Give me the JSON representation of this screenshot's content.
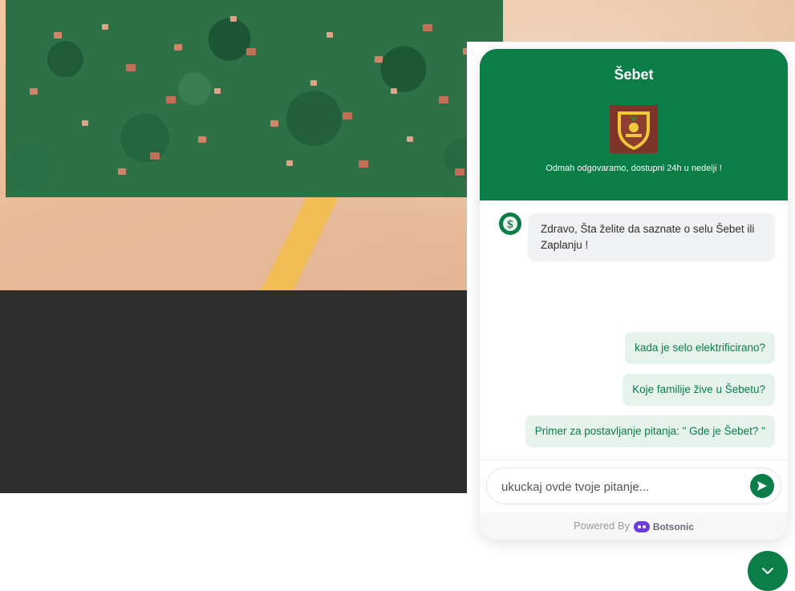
{
  "chat": {
    "title": "Šebet",
    "subtitle": "Odmah odgovaramo, dostupni 24h u nedelji !",
    "bot_message": "Zdravo, Šta želite da saznate o selu Šebet ili Zaplanju !",
    "suggestions": [
      "kada je selo elektrificirano?",
      "Koje familije žive u Šebetu?",
      "Primer za postavljanje pitanja: \" Gde je Šebet? \""
    ],
    "input": {
      "placeholder": "ukuckaj ovde tvoje pitanje...",
      "value": ""
    },
    "footer": {
      "powered_by": "Powered By",
      "brand": "Botsonic"
    }
  },
  "colors": {
    "brand_green": "#0b7d47",
    "suggestion_bg": "#e6f3ec",
    "bot_bubble_bg": "#f1f2f4",
    "dark_band": "#2e2e2e"
  },
  "icons": {
    "avatar": "dollar-s-icon",
    "send": "send-arrow-icon",
    "toggle": "chevron-down-icon",
    "brand": "botsonic-logo-icon",
    "logo": "village-crest-icon"
  }
}
